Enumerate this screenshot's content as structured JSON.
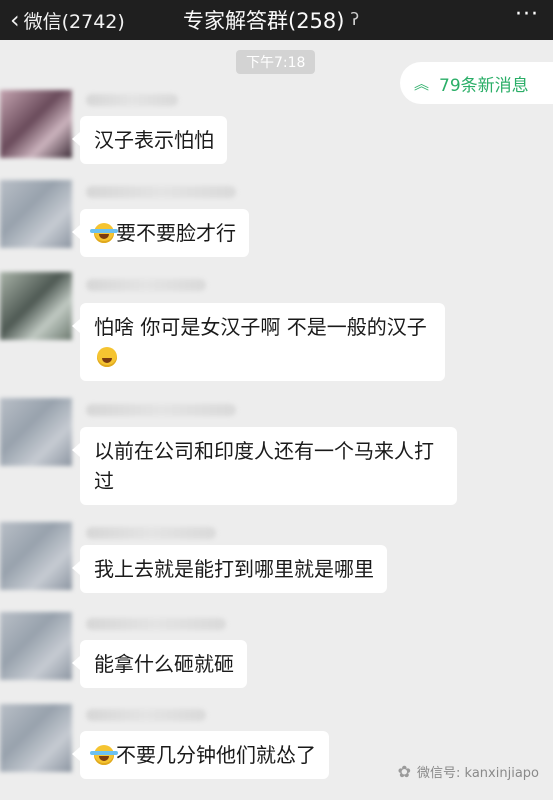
{
  "topbar": {
    "back_label": "微信(2742)",
    "title": "专家解答群(258)",
    "more": "···"
  },
  "time_divider": "下午7:18",
  "new_messages": {
    "label": "79条新消息",
    "icon": "double-chevron-up-icon",
    "color": "#2aae67"
  },
  "messages": [
    {
      "text": "汉子表示怕怕",
      "emoji": ""
    },
    {
      "text": "要不要脸才行",
      "emoji": "leading"
    },
    {
      "text": "怕啥 你可是女汉子啊 不是一般的汉子",
      "emoji": "trailing"
    },
    {
      "text": "以前在公司和印度人还有一个马来人打过",
      "emoji": ""
    },
    {
      "text": "我上去就是能打到哪里就是哪里",
      "emoji": ""
    },
    {
      "text": "能拿什么砸就砸",
      "emoji": ""
    },
    {
      "text": "不要几分钟他们就怂了",
      "emoji": "leading"
    }
  ],
  "watermark": "微信号: kanxinjiapo"
}
